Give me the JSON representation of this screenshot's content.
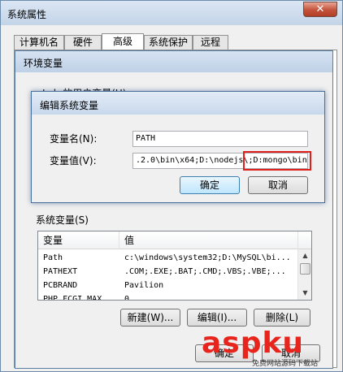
{
  "system_properties": {
    "title": "系统属性",
    "close_glyph": "✕",
    "tabs": [
      {
        "label": "计算机名"
      },
      {
        "label": "硬件"
      },
      {
        "label": "高级",
        "active": true
      },
      {
        "label": "系统保护"
      },
      {
        "label": "远程"
      }
    ]
  },
  "env_dialog": {
    "title": "环境变量",
    "user_vars_label": "Lvh 的用户变量(U)",
    "system_vars_label": "系统变量(S)",
    "columns": [
      "变量",
      "值"
    ],
    "rows": [
      {
        "var": "Path",
        "val": "c:\\windows\\system32;D:\\MySQL\\bi..."
      },
      {
        "var": "PATHEXT",
        "val": ".COM;.EXE;.BAT;.CMD;.VBS;.VBE;..."
      },
      {
        "var": "PCBRAND",
        "val": "Pavilion"
      },
      {
        "var": "PHP_FCGI_MAX_",
        "val": "0"
      }
    ],
    "buttons": {
      "new": "新建(W)...",
      "edit": "编辑(I)...",
      "delete": "删除(L)"
    },
    "ok": "确定",
    "cancel": "取消"
  },
  "edit_dialog": {
    "title": "编辑系统变量",
    "name_label": "变量名(N):",
    "value_label": "变量值(V):",
    "name_value": "PATH",
    "value_value": ".2.0\\bin\\x64;D:\\nodejs\\;D:mongo\\bin\\",
    "ok": "确定",
    "cancel": "取消",
    "highlight_color": "#e0201c"
  },
  "watermark": {
    "logo": "aspku",
    "sub": "免费网站源码下载站"
  }
}
